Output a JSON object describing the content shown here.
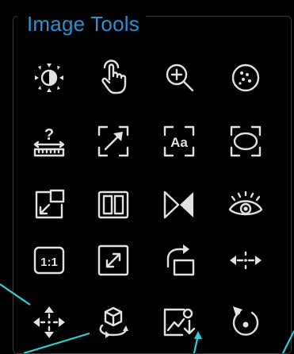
{
  "panel": {
    "title": "Image Tools"
  },
  "tools": [
    {
      "icon": "brightness-contrast-icon"
    },
    {
      "icon": "hand-pointer-icon"
    },
    {
      "icon": "zoom-in-icon"
    },
    {
      "icon": "dotted-circle-icon"
    },
    {
      "icon": "measure-ruler-icon"
    },
    {
      "icon": "diagonal-arrow-icon"
    },
    {
      "icon": "text-annotation-icon"
    },
    {
      "icon": "ellipse-roi-icon"
    },
    {
      "icon": "picture-in-picture-icon"
    },
    {
      "icon": "side-by-side-icon"
    },
    {
      "icon": "flip-horizontal-icon"
    },
    {
      "icon": "eye-icon"
    },
    {
      "icon": "actual-size-icon",
      "label": "1:1"
    },
    {
      "icon": "expand-arrows-icon"
    },
    {
      "icon": "rotate-icon"
    },
    {
      "icon": "horizontal-arrows-icon"
    },
    {
      "icon": "move-arrows-icon"
    },
    {
      "icon": "3d-rotate-icon"
    },
    {
      "icon": "export-image-icon"
    },
    {
      "icon": "reset-icon"
    }
  ],
  "text_annotation_icon_label": "Aa",
  "colors": {
    "title": "#2e8fd4",
    "icon": "#e2e2e2",
    "panel_border": "#3a3a3a",
    "callout_line": "#2fd0da",
    "background": "#000000"
  }
}
